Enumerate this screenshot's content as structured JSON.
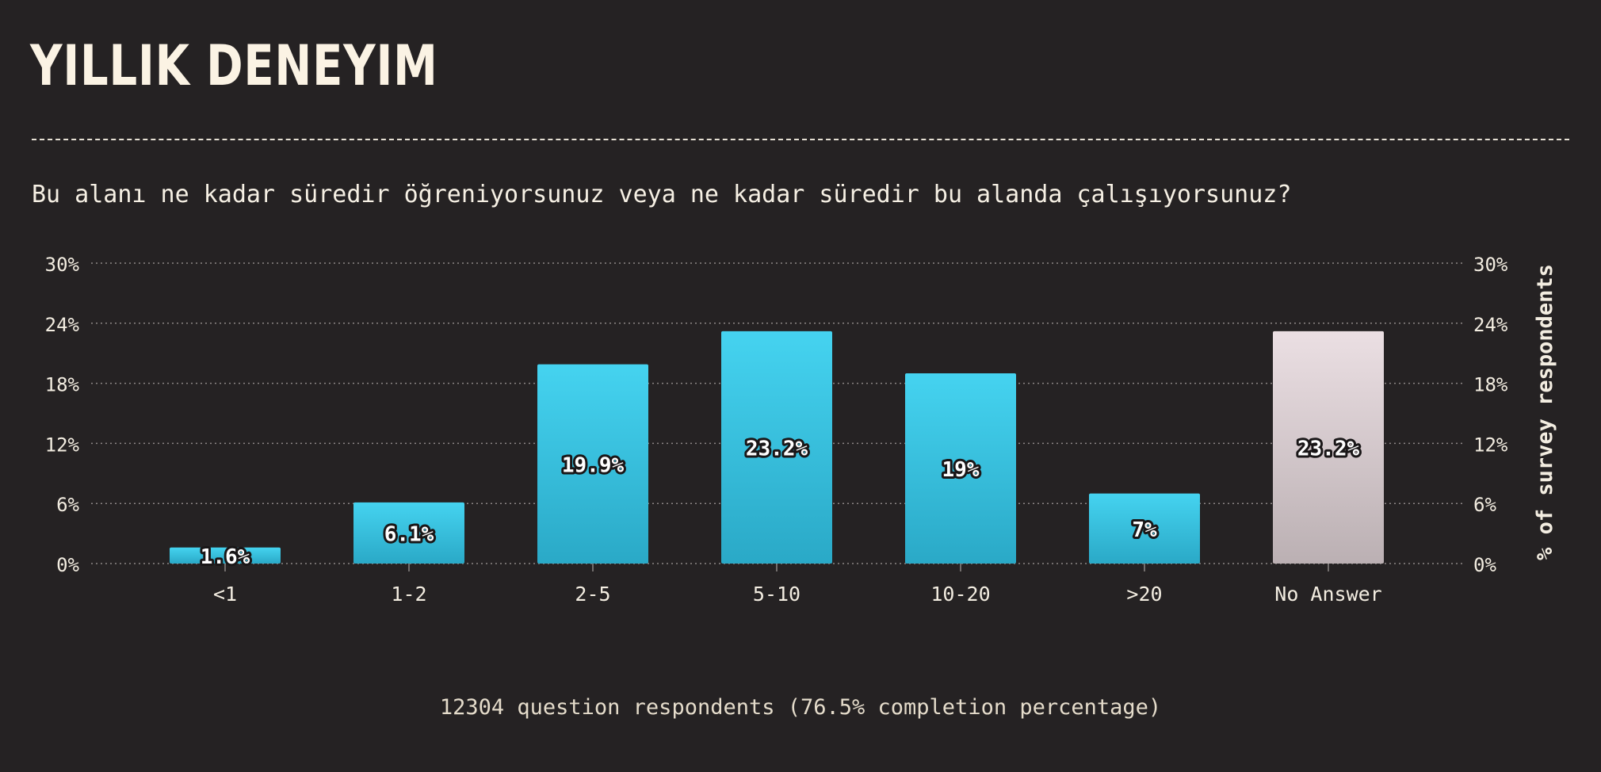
{
  "header": {
    "title": "YILLIK DENEYIM",
    "question": "Bu alanı ne kadar süredir öğreniyorsunuz veya ne kadar süredir bu alanda çalışıyorsunuz?"
  },
  "footer": {
    "text": "12304 question respondents (76.5% completion percentage)"
  },
  "chart_data": {
    "type": "bar",
    "title": "YILLIK DENEYIM",
    "categories": [
      "<1",
      "1-2",
      "2-5",
      "5-10",
      "10-20",
      ">20",
      "No Answer"
    ],
    "values": [
      1.6,
      6.1,
      19.9,
      23.2,
      19,
      7,
      23.2
    ],
    "value_labels": [
      "1.6%",
      "6.1%",
      "19.9%",
      "23.2%",
      "19%",
      "7%",
      "23.2%"
    ],
    "ylabel": "% of survey respondents",
    "ylim": [
      0,
      30
    ],
    "yticks": [
      0,
      6,
      12,
      18,
      24,
      30
    ],
    "ytick_labels": [
      "0%",
      "6%",
      "12%",
      "18%",
      "24%",
      "30%"
    ],
    "grid": true,
    "colors": {
      "bar_top": "#45d3f0",
      "bar_bottom": "#2aa9c7",
      "na_top": "#ebdfe3",
      "na_bottom": "#bbb0b3",
      "label_stroke": "#1a1718"
    }
  }
}
